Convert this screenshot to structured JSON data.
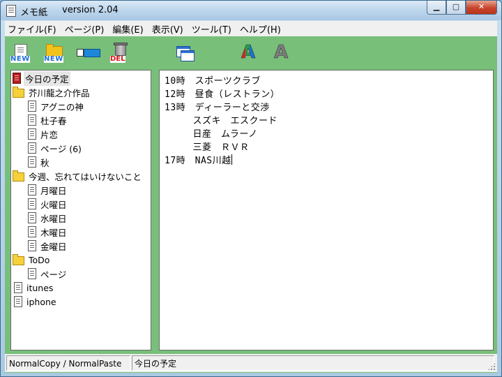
{
  "window": {
    "title": "メモ紙",
    "version": "version 2.04",
    "minimize": "▁",
    "maximize": "▢",
    "close": "✕"
  },
  "menu": [
    "ファイル(F)",
    "ページ(P)",
    "編集(E)",
    "表示(V)",
    "ツール(T)",
    "ヘルプ(H)"
  ],
  "toolbar": {
    "new_page_label": "NEW",
    "new_folder_label": "NEW",
    "delete_label": "DEL",
    "font_color_label": "A",
    "font_label": "A",
    "icons": [
      "new-page-icon",
      "new-folder-icon",
      "rename-icon",
      "trash-icon",
      "windows-icon",
      "font-color-icon",
      "font-icon"
    ]
  },
  "tree": [
    {
      "label": "今日の予定",
      "icon": "red-page",
      "indent": 0,
      "selected": true
    },
    {
      "label": "芥川龍之介作品",
      "icon": "folder",
      "indent": 0
    },
    {
      "label": "アグニの神",
      "icon": "page",
      "indent": 1
    },
    {
      "label": "杜子春",
      "icon": "page",
      "indent": 1
    },
    {
      "label": "片恋",
      "icon": "page",
      "indent": 1
    },
    {
      "label": "ページ (6)",
      "icon": "page",
      "indent": 1
    },
    {
      "label": "秋",
      "icon": "page",
      "indent": 1
    },
    {
      "label": "今週、忘れてはいけないこと",
      "icon": "folder",
      "indent": 0
    },
    {
      "label": "月曜日",
      "icon": "page",
      "indent": 1
    },
    {
      "label": "火曜日",
      "icon": "page",
      "indent": 1
    },
    {
      "label": "水曜日",
      "icon": "page",
      "indent": 1
    },
    {
      "label": "木曜日",
      "icon": "page",
      "indent": 1
    },
    {
      "label": "金曜日",
      "icon": "page",
      "indent": 1
    },
    {
      "label": "ToDo",
      "icon": "folder",
      "indent": 0
    },
    {
      "label": "ページ",
      "icon": "page",
      "indent": 1
    },
    {
      "label": "itunes",
      "icon": "page",
      "indent": 0
    },
    {
      "label": "iphone",
      "icon": "page",
      "indent": 0
    }
  ],
  "editor": {
    "lines": [
      "10時　スポーツクラブ",
      "12時　昼食（レストラン）",
      "13時　ディーラーと交渉",
      "　　　スズキ　エスクード",
      "　　　日産　ムラーノ",
      "　　　三菱　ＲＶＲ",
      "17時　NAS川越"
    ]
  },
  "status": {
    "mode": "NormalCopy / NormalPaste",
    "current_page": "今日の予定"
  },
  "colors": {
    "client_background": "#78bf7a",
    "selected_item_background": "#e6e6e6"
  }
}
